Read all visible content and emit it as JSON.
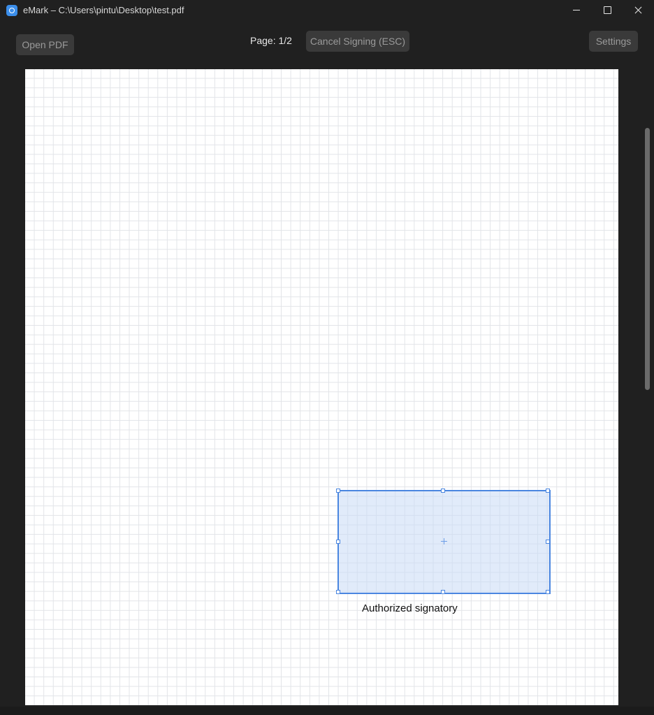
{
  "window": {
    "title": "eMark – C:\\Users\\pintu\\Desktop\\test.pdf",
    "icon": "app-logo-icon"
  },
  "toolbar": {
    "open_pdf_label": "Open PDF",
    "page_indicator": "Page: 1/2",
    "cancel_signing_label": "Cancel Signing (ESC)",
    "settings_label": "Settings"
  },
  "document": {
    "signature_caption": "Authorized signatory"
  },
  "colors": {
    "accent": "#4a86e0",
    "selection_fill": "#c8daf5",
    "window_bg": "#202020",
    "button_bg": "#3a3a3a"
  }
}
